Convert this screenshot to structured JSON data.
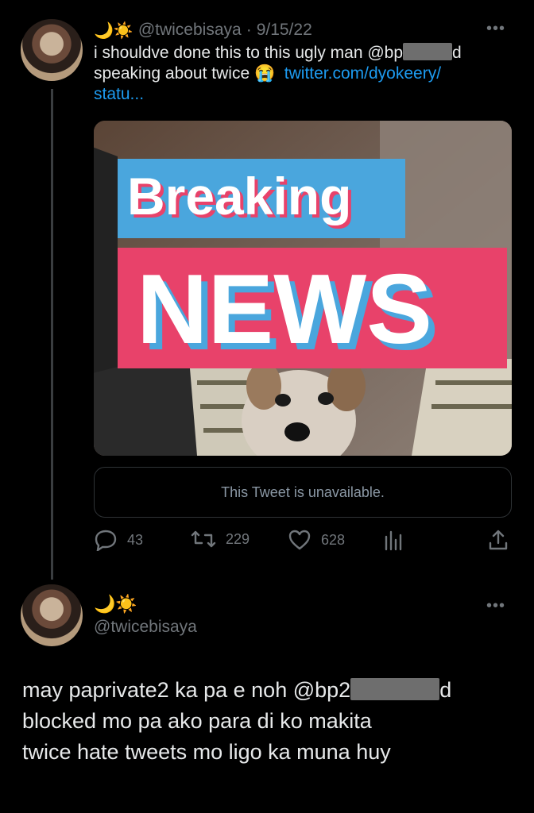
{
  "tweet1": {
    "emoji": "🌙☀️",
    "handle": "@twicebisaya",
    "separator": "·",
    "date": "9/15/22",
    "more": "•••",
    "text_line1_prefix": "i shouldve done this to this ugly man @bp",
    "text_line1_suffix": "d",
    "text_line2_prefix": "speaking about twice ",
    "crying_emoji": "😭",
    "link_part1": "twitter.com/dyokeery/",
    "link_part2": "statu...",
    "media": {
      "headline_word1": "Breaking",
      "headline_word2": "NEWS",
      "colors": {
        "blue": "#4aa6dd",
        "pink": "#e8426a",
        "white": "#ffffff"
      }
    },
    "quote_unavailable": "This Tweet is unavailable.",
    "replies": "43",
    "retweets": "229",
    "likes": "628"
  },
  "tweet2": {
    "emoji": "🌙☀️",
    "handle": "@twicebisaya",
    "more": "•••",
    "line1_prefix": "may paprivate2 ka pa e noh @bp2",
    "line1_suffix": "d",
    "line2": "blocked mo pa ako para di ko makita",
    "line3": "twice hate tweets mo ligo ka muna huy"
  }
}
